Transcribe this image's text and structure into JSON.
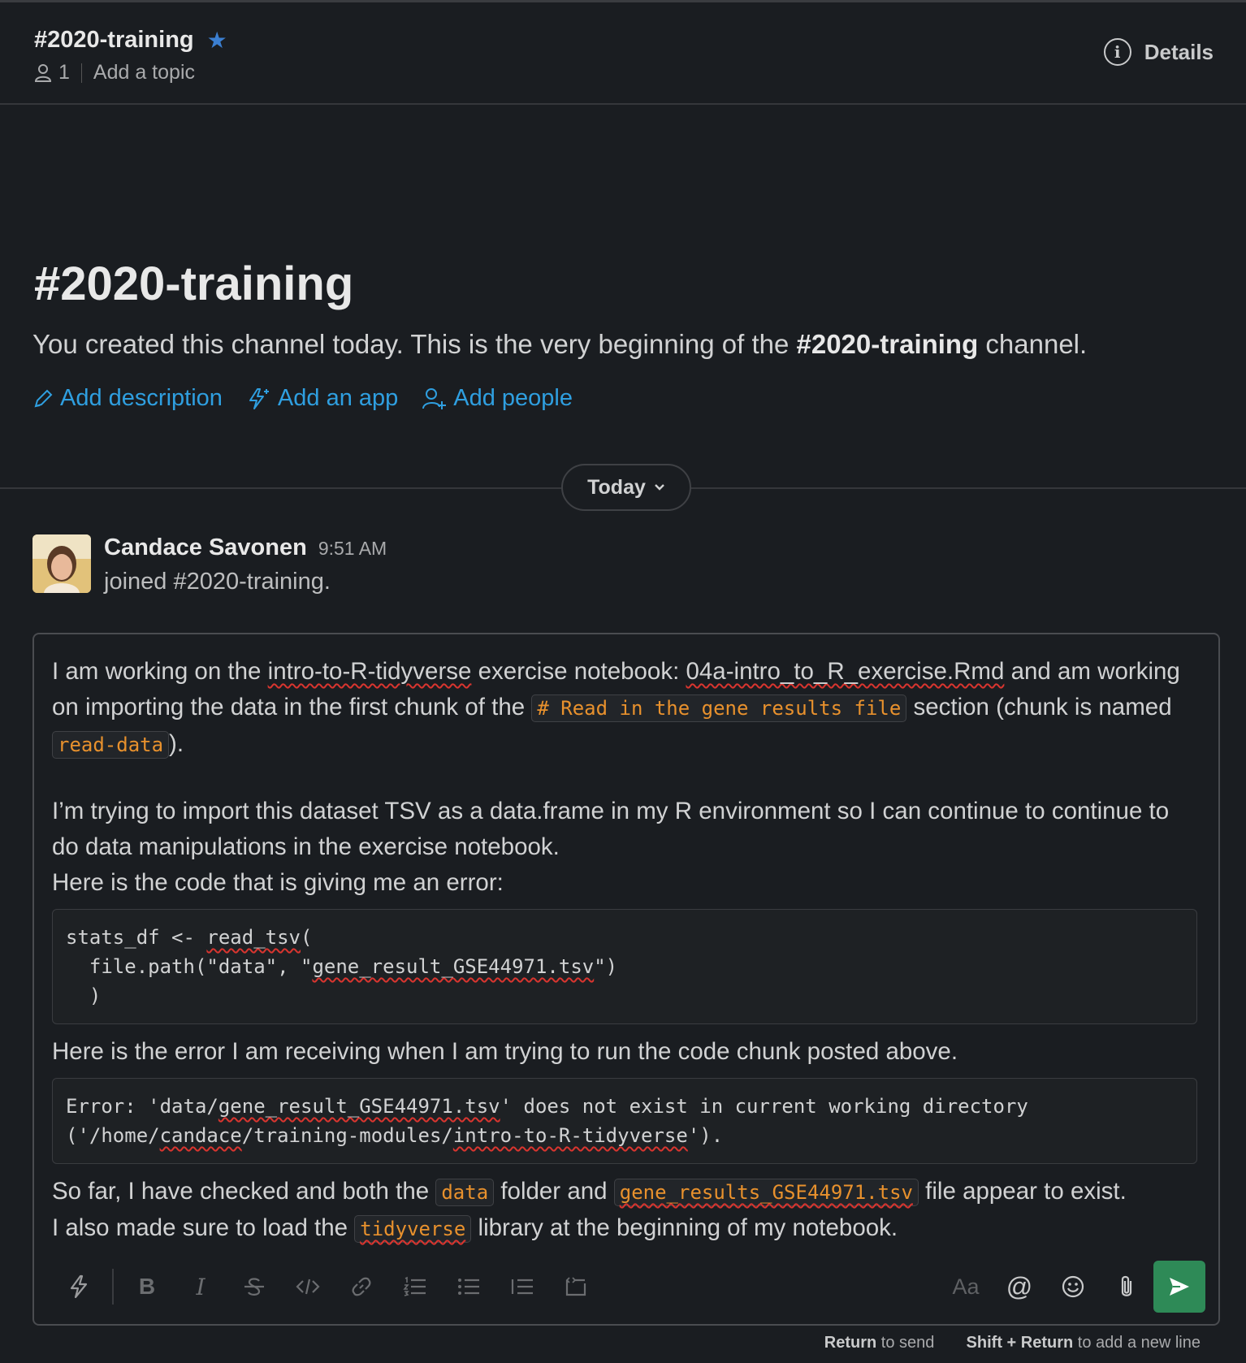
{
  "header": {
    "channel_name": "#2020-training",
    "member_count": "1",
    "add_topic": "Add a topic",
    "details_label": "Details"
  },
  "intro": {
    "title": "#2020-training",
    "text_before": "You created this channel today. This is the very beginning of the ",
    "channel_bold": "#2020-training",
    "text_after": " channel.",
    "actions": {
      "add_description": "Add description",
      "add_app": "Add an app",
      "add_people": "Add people"
    }
  },
  "date_divider": {
    "label": "Today"
  },
  "message": {
    "author": "Candace Savonen",
    "time": "9:51 AM",
    "text": "joined #2020-training."
  },
  "composer": {
    "p1": {
      "t1": "I am working on the ",
      "s1": "intro-to-R-tidyverse",
      "t2": " exercise notebook: ",
      "s2": "04a-intro_to_R_exercise.Rmd",
      "t3": " and am working on importing the data in the first chunk of the ",
      "c1": "# Read in the gene results file",
      "t4": " section (chunk is named ",
      "c2": "read-data",
      "t5": ")."
    },
    "p2": "I’m trying to import this dataset TSV as a data.frame in my R environment so I can continue to continue to do data manipulations in the exercise notebook.",
    "p3": "Here is the code that is giving me an error:",
    "code": {
      "l1a": "stats_df <- ",
      "l1b": "read_tsv",
      "l1c": "(",
      "l2a": "  file.path(\"data\", \"",
      "l2b": "gene_result_GSE44971.tsv",
      "l2c": "\")",
      "l3": "  )"
    },
    "p4": "Here is the error I am receiving when I am trying to run the code chunk posted above.",
    "error": {
      "a": "Error: 'data/",
      "b": "gene_result_GSE44971.tsv",
      "c": "' does not exist in current working directory",
      "d": "('/home/",
      "e": "candace",
      "f": "/training-modules/",
      "g": "intro-to-R-tidyverse",
      "h": "')."
    },
    "p5": {
      "t1": "So far, I have checked and both the ",
      "c1": "data",
      "t2": " folder and ",
      "c2": "gene_results_GSE44971.tsv",
      "t3": " file appear to exist."
    },
    "p6": {
      "t1": "I also made sure to load the ",
      "c1": "tidyverse",
      "t2": " library at the beginning of my notebook."
    },
    "toolbar": {
      "bold": "B",
      "italic": "I",
      "format_toggle": "Aa"
    }
  },
  "hint": {
    "return_key": "Return",
    "return_text": " to send",
    "shift_return_key": "Shift + Return",
    "shift_return_text": " to add a new line"
  },
  "colors": {
    "background": "#1a1d21",
    "link": "#2f9fe0",
    "inline_code": "#e8912d",
    "send_button": "#2e8a57",
    "star": "#3b7fd1"
  }
}
